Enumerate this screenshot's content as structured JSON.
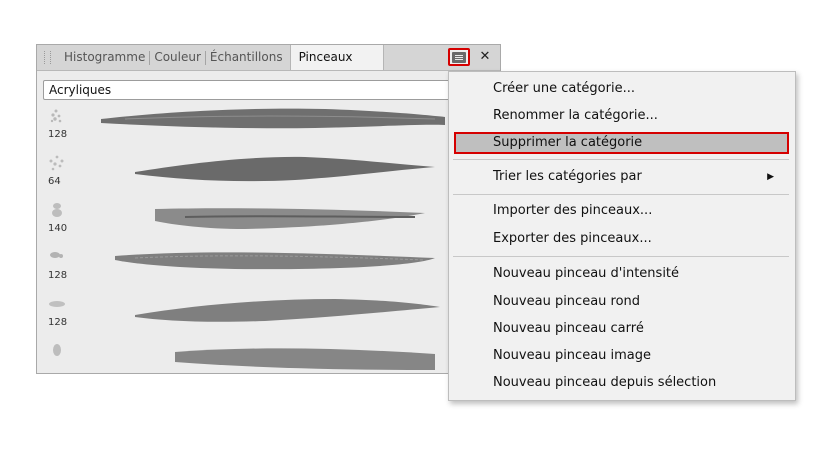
{
  "panel": {
    "tabs": [
      {
        "label": "Histogramme",
        "active": false
      },
      {
        "label": "Couleur",
        "active": false
      },
      {
        "label": "Échantillons",
        "active": false
      },
      {
        "label": "Pinceaux",
        "active": true
      }
    ],
    "category": "Acryliques",
    "brushes": [
      {
        "size": "128"
      },
      {
        "size": "64"
      },
      {
        "size": "140"
      },
      {
        "size": "128"
      },
      {
        "size": "128"
      },
      {
        "size": ""
      }
    ]
  },
  "menu": {
    "items": [
      {
        "label": "Créer une catégorie...",
        "highlighted": false
      },
      {
        "label": "Renommer la catégorie...",
        "highlighted": false
      },
      {
        "label": "Supprimer la catégorie",
        "highlighted": true
      },
      {
        "label": "Trier les catégories par",
        "has_submenu": true
      },
      {
        "label": "Importer des pinceaux..."
      },
      {
        "label": "Exporter des pinceaux..."
      },
      {
        "label": "Nouveau pinceau d'intensité"
      },
      {
        "label": "Nouveau pinceau rond"
      },
      {
        "label": "Nouveau pinceau carré"
      },
      {
        "label": "Nouveau pinceau image"
      },
      {
        "label": "Nouveau pinceau depuis sélection"
      }
    ],
    "submenu_icon": "triangle-right-icon"
  },
  "colors": {
    "highlight_border": "#d50000",
    "highlight_bg": "#bfbfbf",
    "brush_gray": "#6e6e6e"
  },
  "icons": {
    "panel_menu": "hamburger-menu-icon",
    "close": "close-icon",
    "grip": "drag-grip-icon"
  }
}
